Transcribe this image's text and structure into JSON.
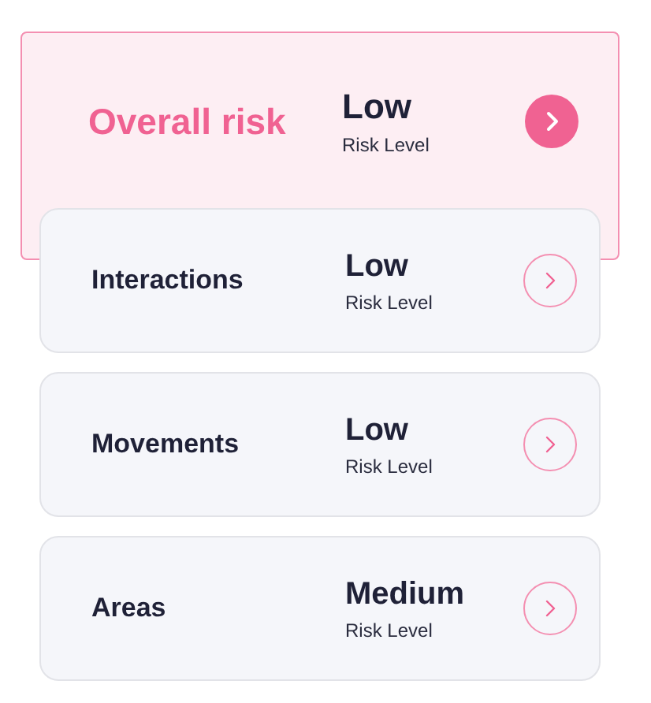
{
  "overall": {
    "title": "Overall risk",
    "value": "Low",
    "caption": "Risk Level"
  },
  "categories": [
    {
      "label": "Interactions",
      "value": "Low",
      "caption": "Risk Level"
    },
    {
      "label": "Movements",
      "value": "Low",
      "caption": "Risk Level"
    },
    {
      "label": "Areas",
      "value": "Medium",
      "caption": "Risk Level"
    }
  ]
}
